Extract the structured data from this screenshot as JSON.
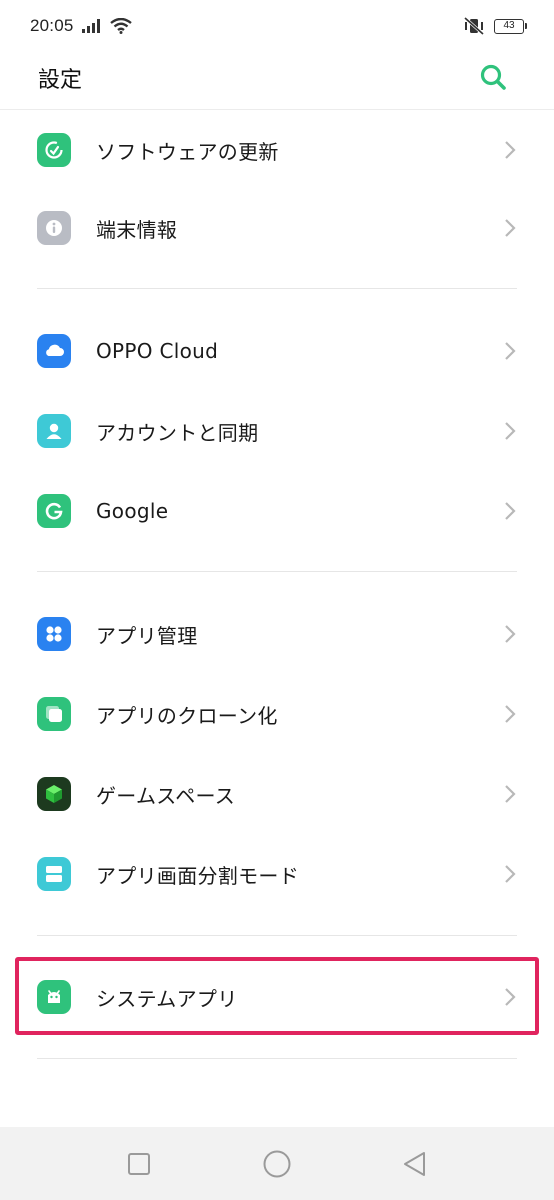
{
  "status": {
    "time": "20:05",
    "battery": "43"
  },
  "header": {
    "title": "設定"
  },
  "colors": {
    "accent": "#2fc27c",
    "highlight": "#e0245e"
  },
  "items": [
    {
      "label": "ソフトウェアの更新",
      "icon": "software-update-icon",
      "color": "#2fc27c"
    },
    {
      "label": "端末情報",
      "icon": "info-icon",
      "color": "#b9bcc4"
    },
    {
      "label": "OPPO Cloud",
      "icon": "cloud-icon",
      "color": "#2a82f0"
    },
    {
      "label": "アカウントと同期",
      "icon": "account-icon",
      "color": "#3ec9d6"
    },
    {
      "label": "Google",
      "icon": "google-icon",
      "color": "#2fc27c"
    },
    {
      "label": "アプリ管理",
      "icon": "app-management-icon",
      "color": "#2a82f0"
    },
    {
      "label": "アプリのクローン化",
      "icon": "app-clone-icon",
      "color": "#2fc27c"
    },
    {
      "label": "ゲームスペース",
      "icon": "game-space-icon",
      "color": "#1d3a1f"
    },
    {
      "label": "アプリ画面分割モード",
      "icon": "split-screen-icon",
      "color": "#3ec9d6"
    },
    {
      "label": "システムアプリ",
      "icon": "system-apps-icon",
      "color": "#2fc27c"
    }
  ]
}
